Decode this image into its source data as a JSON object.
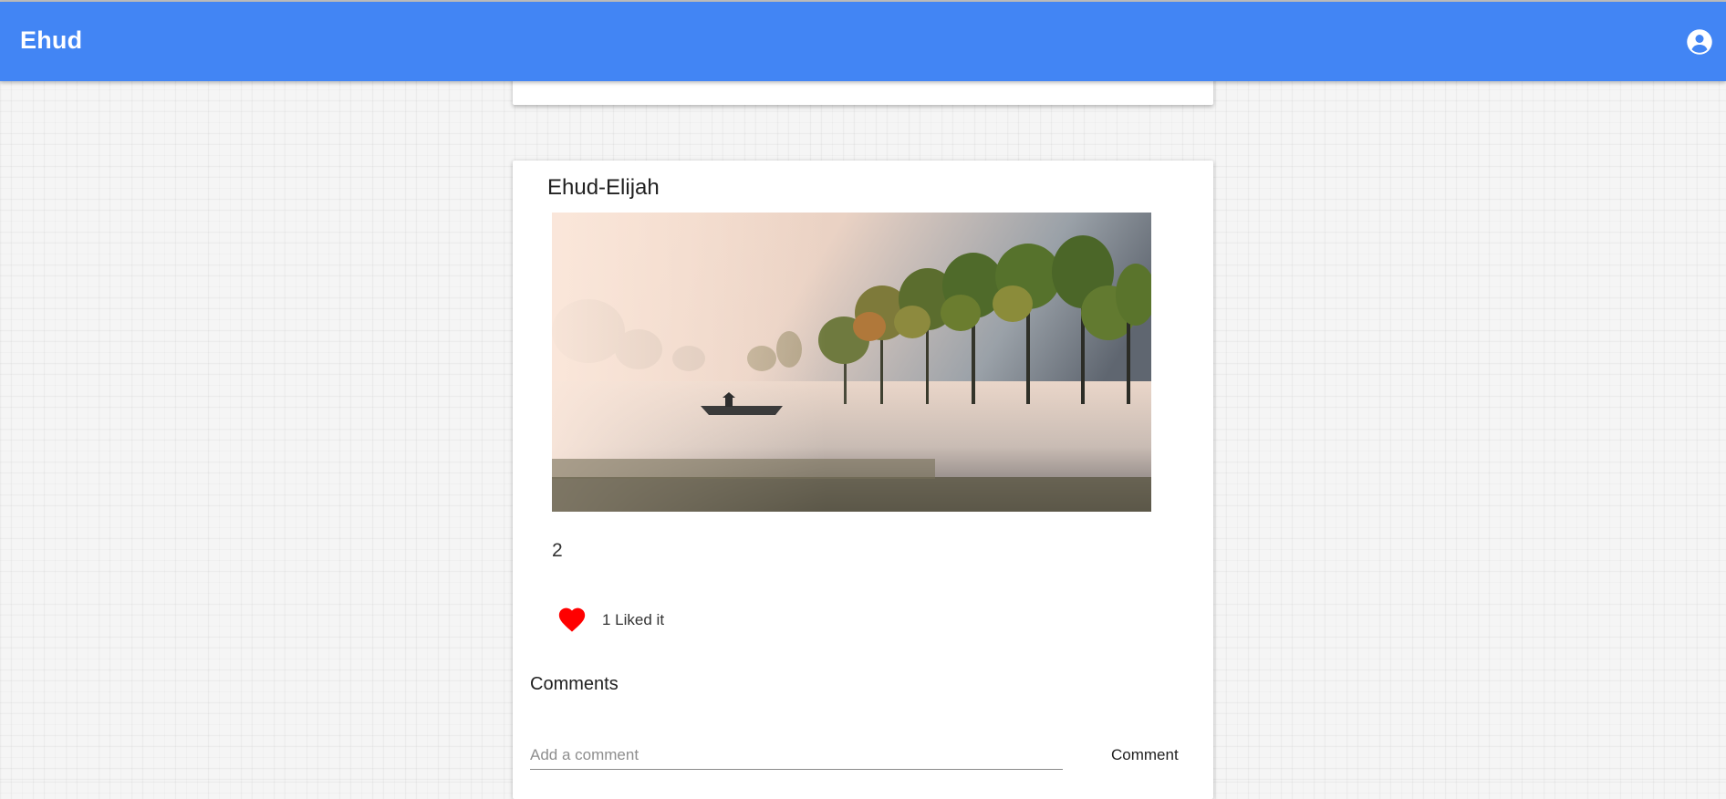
{
  "app": {
    "title": "Ehud"
  },
  "header": {
    "account_icon": "account-circle-icon",
    "color": "#4285f4"
  },
  "post": {
    "author": "Ehud-Elijah",
    "image_description_icon": "misty-lake-boat-photo",
    "caption": "2",
    "like_icon": "heart-icon",
    "like_color": "#ff0000",
    "likes_text": "1 Liked it"
  },
  "comments": {
    "heading": "Comments",
    "input_placeholder": "Add a comment",
    "input_value": "",
    "submit_label": "Comment"
  }
}
